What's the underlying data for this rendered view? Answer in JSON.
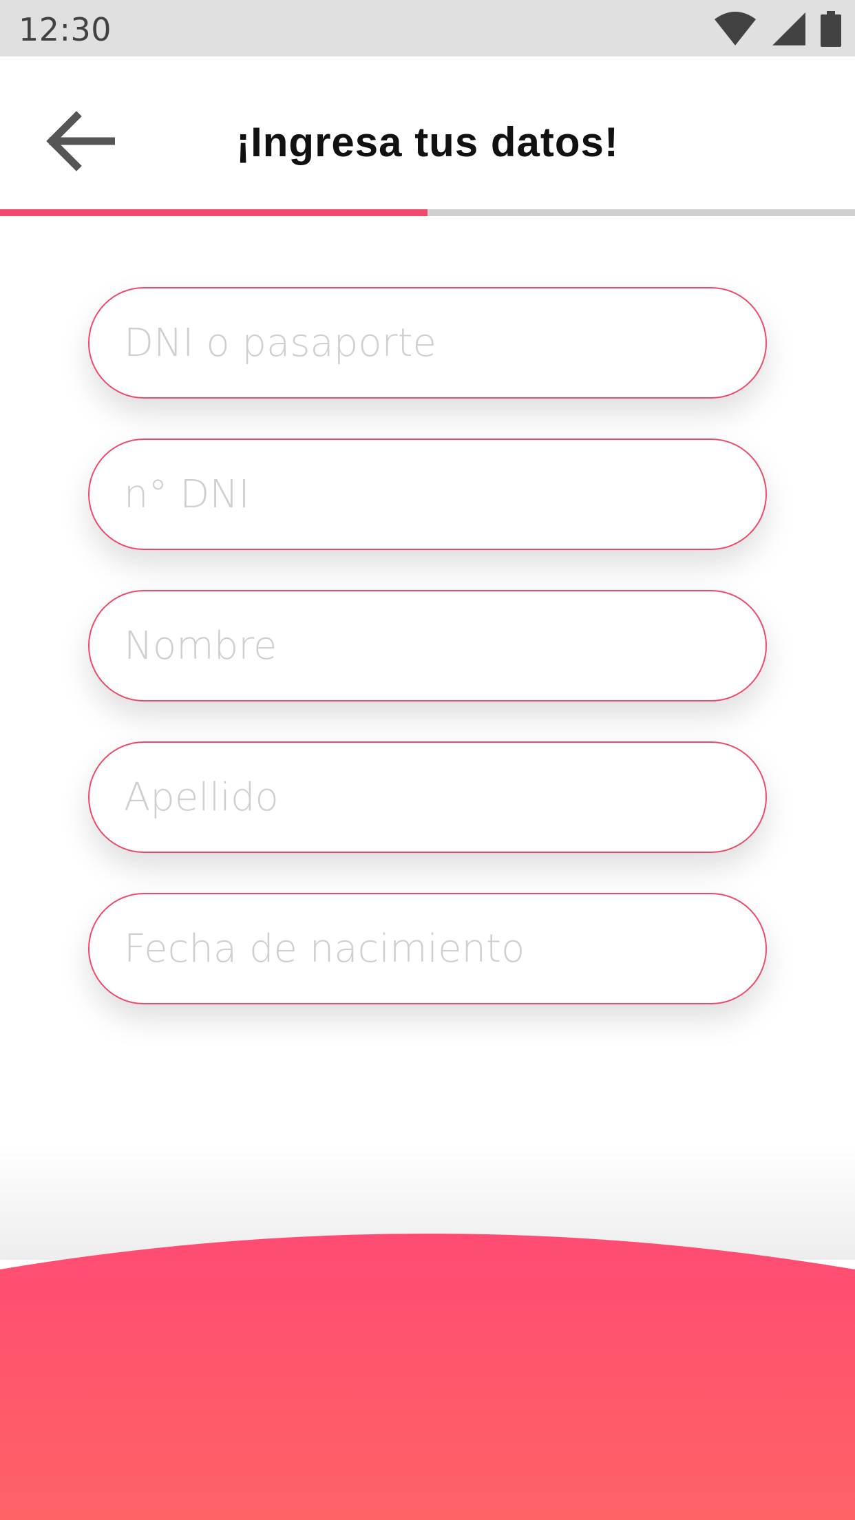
{
  "status_bar": {
    "time": "12:30",
    "icons": [
      "wifi-icon",
      "cellular-signal-icon",
      "battery-icon"
    ]
  },
  "app_bar": {
    "back_icon": "arrow-back-icon",
    "title": "¡Ingresa tus datos!"
  },
  "progress": {
    "fraction": 0.5,
    "fill_color": "#f1486c",
    "track_color": "#d0d0d0"
  },
  "form": {
    "fields": [
      {
        "placeholder": "DNI o pasaporte",
        "value": ""
      },
      {
        "placeholder": "n° DNI",
        "value": ""
      },
      {
        "placeholder": "Nombre",
        "value": ""
      },
      {
        "placeholder": "Apellido",
        "value": ""
      },
      {
        "placeholder": "Fecha de nacimiento",
        "value": ""
      }
    ]
  },
  "colors": {
    "accent": "#ec4a6b",
    "wave_top": "#ff4b72",
    "wave_bottom": "#ff6366"
  }
}
